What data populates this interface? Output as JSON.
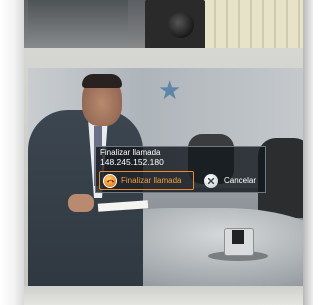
{
  "dialog": {
    "title": "Finalizar llamada",
    "address": "148.245.152.180",
    "end_call_label": "Finalizar llamada",
    "cancel_label": "Cancelar"
  },
  "icons": {
    "end_call": "end-call-icon",
    "cancel": "cancel-icon"
  },
  "colors": {
    "dialog_bg": "#14181e",
    "focus_accent": "#e98a2a",
    "focused_text": "#f2a13a",
    "text": "#ffffff"
  }
}
